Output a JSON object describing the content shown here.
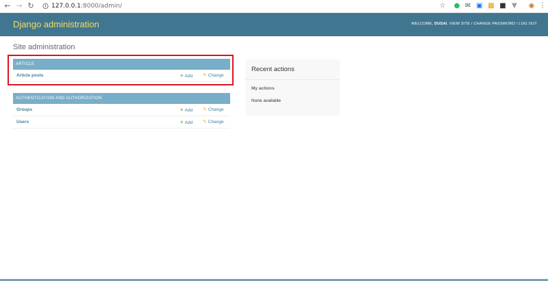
{
  "browser": {
    "url_host": "127.0.0.1",
    "url_rest": ":8000/admin/"
  },
  "header": {
    "branding": "Django administration",
    "welcome": "WELCOME,",
    "username": "DUSAI",
    "view_site": "VIEW SITE",
    "change_password": "CHANGE PASSWORD",
    "log_out": "LOG OUT",
    "separator": " / "
  },
  "page": {
    "title": "Site administration"
  },
  "apps": [
    {
      "caption": "ARTICLE",
      "models": [
        {
          "name": "Article posts",
          "add": "Add",
          "change": "Change"
        }
      ]
    },
    {
      "caption": "AUTHENTICATION AND AUTHORIZATION",
      "models": [
        {
          "name": "Groups",
          "add": "Add",
          "change": "Change"
        },
        {
          "name": "Users",
          "add": "Add",
          "change": "Change"
        }
      ]
    }
  ],
  "recent": {
    "title": "Recent actions",
    "subtitle": "My actions",
    "empty": "None available"
  },
  "colors": {
    "header_bg": "#417690",
    "branding": "#f5dd5d",
    "caption_bg": "#79aec8",
    "link": "#447e9b",
    "highlight": "#d9141e"
  },
  "icons": {
    "back": "arrow-left-icon",
    "forward": "arrow-right-icon",
    "reload": "reload-icon",
    "secure": "info-icon",
    "bookmark": "star-icon",
    "menu": "kebab-menu-icon"
  }
}
